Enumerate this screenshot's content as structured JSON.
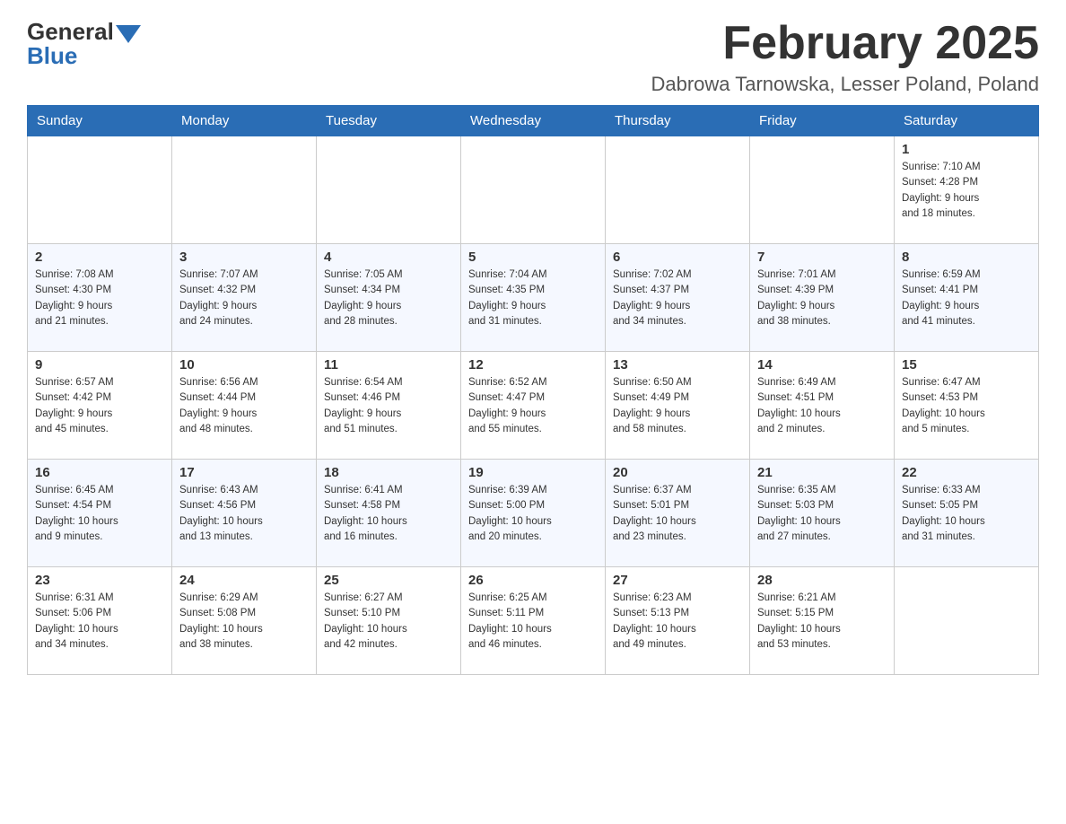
{
  "logo": {
    "general": "General",
    "blue": "Blue"
  },
  "title": "February 2025",
  "subtitle": "Dabrowa Tarnowska, Lesser Poland, Poland",
  "days_of_week": [
    "Sunday",
    "Monday",
    "Tuesday",
    "Wednesday",
    "Thursday",
    "Friday",
    "Saturday"
  ],
  "weeks": [
    {
      "days": [
        {
          "num": "",
          "info": ""
        },
        {
          "num": "",
          "info": ""
        },
        {
          "num": "",
          "info": ""
        },
        {
          "num": "",
          "info": ""
        },
        {
          "num": "",
          "info": ""
        },
        {
          "num": "",
          "info": ""
        },
        {
          "num": "1",
          "info": "Sunrise: 7:10 AM\nSunset: 4:28 PM\nDaylight: 9 hours\nand 18 minutes."
        }
      ]
    },
    {
      "days": [
        {
          "num": "2",
          "info": "Sunrise: 7:08 AM\nSunset: 4:30 PM\nDaylight: 9 hours\nand 21 minutes."
        },
        {
          "num": "3",
          "info": "Sunrise: 7:07 AM\nSunset: 4:32 PM\nDaylight: 9 hours\nand 24 minutes."
        },
        {
          "num": "4",
          "info": "Sunrise: 7:05 AM\nSunset: 4:34 PM\nDaylight: 9 hours\nand 28 minutes."
        },
        {
          "num": "5",
          "info": "Sunrise: 7:04 AM\nSunset: 4:35 PM\nDaylight: 9 hours\nand 31 minutes."
        },
        {
          "num": "6",
          "info": "Sunrise: 7:02 AM\nSunset: 4:37 PM\nDaylight: 9 hours\nand 34 minutes."
        },
        {
          "num": "7",
          "info": "Sunrise: 7:01 AM\nSunset: 4:39 PM\nDaylight: 9 hours\nand 38 minutes."
        },
        {
          "num": "8",
          "info": "Sunrise: 6:59 AM\nSunset: 4:41 PM\nDaylight: 9 hours\nand 41 minutes."
        }
      ]
    },
    {
      "days": [
        {
          "num": "9",
          "info": "Sunrise: 6:57 AM\nSunset: 4:42 PM\nDaylight: 9 hours\nand 45 minutes."
        },
        {
          "num": "10",
          "info": "Sunrise: 6:56 AM\nSunset: 4:44 PM\nDaylight: 9 hours\nand 48 minutes."
        },
        {
          "num": "11",
          "info": "Sunrise: 6:54 AM\nSunset: 4:46 PM\nDaylight: 9 hours\nand 51 minutes."
        },
        {
          "num": "12",
          "info": "Sunrise: 6:52 AM\nSunset: 4:47 PM\nDaylight: 9 hours\nand 55 minutes."
        },
        {
          "num": "13",
          "info": "Sunrise: 6:50 AM\nSunset: 4:49 PM\nDaylight: 9 hours\nand 58 minutes."
        },
        {
          "num": "14",
          "info": "Sunrise: 6:49 AM\nSunset: 4:51 PM\nDaylight: 10 hours\nand 2 minutes."
        },
        {
          "num": "15",
          "info": "Sunrise: 6:47 AM\nSunset: 4:53 PM\nDaylight: 10 hours\nand 5 minutes."
        }
      ]
    },
    {
      "days": [
        {
          "num": "16",
          "info": "Sunrise: 6:45 AM\nSunset: 4:54 PM\nDaylight: 10 hours\nand 9 minutes."
        },
        {
          "num": "17",
          "info": "Sunrise: 6:43 AM\nSunset: 4:56 PM\nDaylight: 10 hours\nand 13 minutes."
        },
        {
          "num": "18",
          "info": "Sunrise: 6:41 AM\nSunset: 4:58 PM\nDaylight: 10 hours\nand 16 minutes."
        },
        {
          "num": "19",
          "info": "Sunrise: 6:39 AM\nSunset: 5:00 PM\nDaylight: 10 hours\nand 20 minutes."
        },
        {
          "num": "20",
          "info": "Sunrise: 6:37 AM\nSunset: 5:01 PM\nDaylight: 10 hours\nand 23 minutes."
        },
        {
          "num": "21",
          "info": "Sunrise: 6:35 AM\nSunset: 5:03 PM\nDaylight: 10 hours\nand 27 minutes."
        },
        {
          "num": "22",
          "info": "Sunrise: 6:33 AM\nSunset: 5:05 PM\nDaylight: 10 hours\nand 31 minutes."
        }
      ]
    },
    {
      "days": [
        {
          "num": "23",
          "info": "Sunrise: 6:31 AM\nSunset: 5:06 PM\nDaylight: 10 hours\nand 34 minutes."
        },
        {
          "num": "24",
          "info": "Sunrise: 6:29 AM\nSunset: 5:08 PM\nDaylight: 10 hours\nand 38 minutes."
        },
        {
          "num": "25",
          "info": "Sunrise: 6:27 AM\nSunset: 5:10 PM\nDaylight: 10 hours\nand 42 minutes."
        },
        {
          "num": "26",
          "info": "Sunrise: 6:25 AM\nSunset: 5:11 PM\nDaylight: 10 hours\nand 46 minutes."
        },
        {
          "num": "27",
          "info": "Sunrise: 6:23 AM\nSunset: 5:13 PM\nDaylight: 10 hours\nand 49 minutes."
        },
        {
          "num": "28",
          "info": "Sunrise: 6:21 AM\nSunset: 5:15 PM\nDaylight: 10 hours\nand 53 minutes."
        },
        {
          "num": "",
          "info": ""
        }
      ]
    }
  ]
}
